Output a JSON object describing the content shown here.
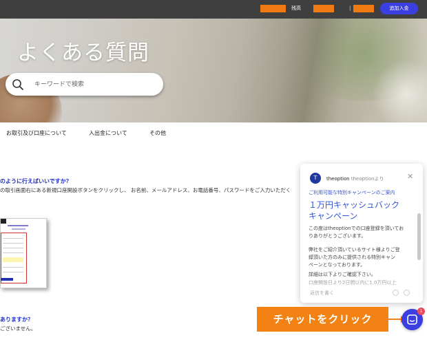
{
  "topbar": {
    "balance_label": "残高",
    "separator": "|",
    "deposit_button": "追加入金"
  },
  "hero": {
    "title": "よくある質問",
    "search_placeholder": "キーワードで検索"
  },
  "tabs": [
    {
      "label": "お取引及び口座について"
    },
    {
      "label": "入出金について"
    },
    {
      "label": "その他"
    }
  ],
  "faq": [
    {
      "question": "のように行えばいいですか？",
      "answer": "の取引画面右にある新規口座開設ボタンをクリックし、 お名前、メールアドレス、お電話番号、パスワードをご入力いただく"
    },
    {
      "question": "ありますか？",
      "answer": "ございません。"
    }
  ],
  "chat": {
    "avatar_letter": "T",
    "sender_name": "theoption",
    "sender_from": "theoptionより",
    "intro": "ご利用可能な特別キャンペーンのご案内",
    "headline_1": "１万円キャッシュバック",
    "headline_2": "キャンペーン",
    "p1_l1": "この度はtheoptionでの口座登録を頂いてお",
    "p1_l2": "りありがとうございます。",
    "p2_l1": "弊社をご紹介頂いているサイト様よりご登",
    "p2_l2": "録頂いた方のみに提供される特別キャン",
    "p2_l3": "ペーンとなっております。",
    "p3_l1": "詳細は以下よりご確認下さい。",
    "p3_l2": "口座開設日より2日間以内に1,0万円以上",
    "reply_placeholder": "返信を書く"
  },
  "cta": {
    "label": "チャットをクリック"
  },
  "launcher": {
    "badge_count": "1"
  },
  "colors": {
    "topbar_bg": "#3f3f3f",
    "accent_orange": "#f28214",
    "primary_blue": "#3b3fe0",
    "link_blue": "#1a2ccc",
    "badge_red": "#e84a5f"
  }
}
